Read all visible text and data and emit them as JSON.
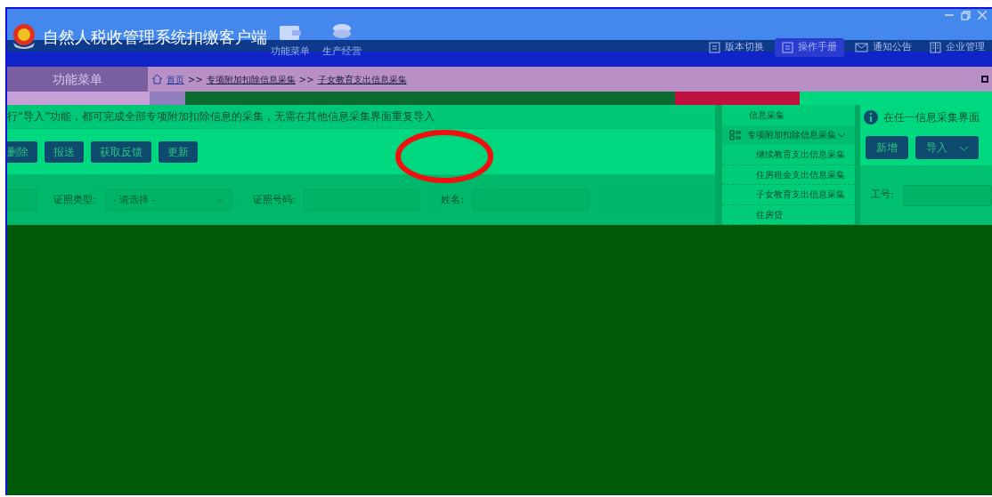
{
  "window": {
    "title": "自然人税收管理系统扣缴客户端"
  },
  "top_nav": [
    {
      "label": "功能菜单",
      "kind": "wallet"
    },
    {
      "label": "生产经营",
      "kind": "coins"
    }
  ],
  "toolbar_links": [
    {
      "label": "版本切换",
      "kind": "doc",
      "selected": false
    },
    {
      "label": "操作手册",
      "kind": "doc",
      "selected": true
    },
    {
      "label": "通知公告",
      "kind": "mail",
      "selected": false
    },
    {
      "label": "企业管理",
      "kind": "building",
      "selected": false
    }
  ],
  "sidebar_tab": "功能菜单",
  "breadcrumb": [
    {
      "label": "首页",
      "kind": "home"
    },
    {
      "label": ">>",
      "kind": "sep"
    },
    {
      "label": "专项附加扣除信息采集",
      "kind": "link"
    },
    {
      "label": ">>",
      "kind": "sep"
    },
    {
      "label": "子女教育支出信息采集",
      "kind": "link"
    }
  ],
  "notice": "行“导入”功能，都可完成全部专项附加扣除信息的采集，无需在其他信息采集界面重复导入",
  "actions": [
    "删除",
    "报送",
    "获取反馈",
    "更新"
  ],
  "filters": [
    {
      "kind": "input"
    },
    {
      "label": "证照类型:",
      "kind": "select",
      "value": "- 请选择 -"
    },
    {
      "label": "证照号码:",
      "kind": "input"
    },
    {
      "label": "姓名:",
      "kind": "input"
    }
  ],
  "tree": [
    {
      "label": "信息采集"
    },
    {
      "label": "专项附加扣除信息采集",
      "expanded": true,
      "children": [
        {
          "label": "继续教育支出信息采集"
        },
        {
          "label": "住房租金支出信息采集"
        },
        {
          "label": "子女教育支出信息采集"
        },
        {
          "label": "住房贷"
        }
      ]
    }
  ],
  "right_panel": {
    "info": "在任一信息采集界面",
    "buttons": [
      {
        "label": "新增",
        "kind": "plain"
      },
      {
        "label": "导入",
        "kind": "dropdown"
      }
    ],
    "fields": [
      {
        "label": "工号:"
      }
    ]
  }
}
